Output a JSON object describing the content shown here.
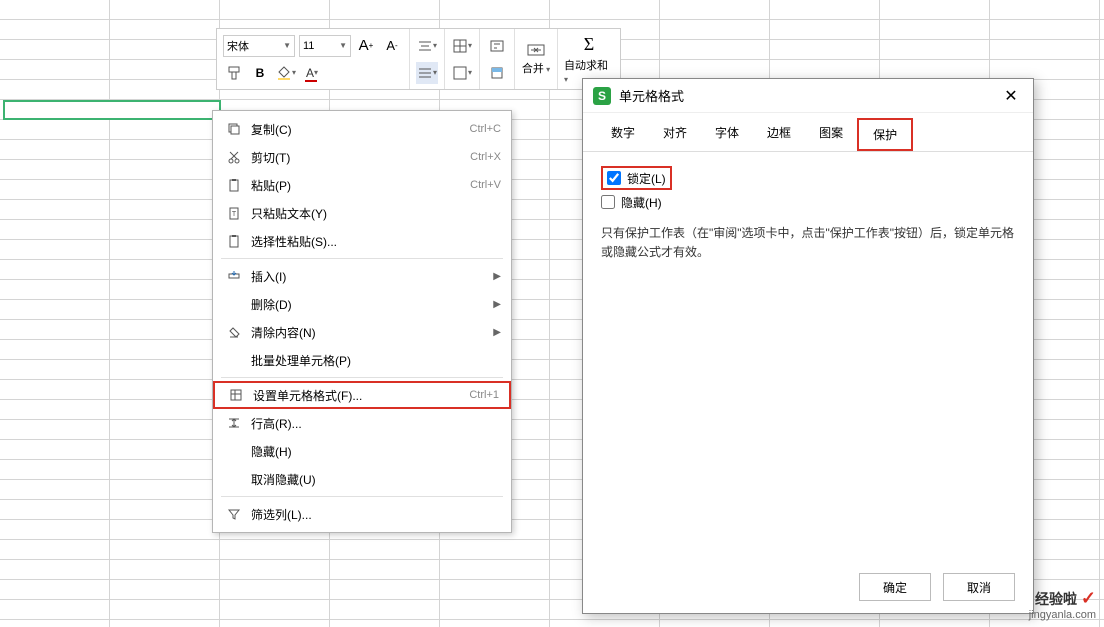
{
  "toolbar": {
    "font": "宋体",
    "size": "11",
    "merge_label": "合并",
    "autosum_label": "自动求和"
  },
  "context_menu": [
    {
      "icon": "copy",
      "label": "复制(C)",
      "shortcut": "Ctrl+C",
      "type": "item"
    },
    {
      "icon": "cut",
      "label": "剪切(T)",
      "shortcut": "Ctrl+X",
      "type": "item"
    },
    {
      "icon": "paste",
      "label": "粘贴(P)",
      "shortcut": "Ctrl+V",
      "type": "item"
    },
    {
      "icon": "paste-text",
      "label": "只粘贴文本(Y)",
      "shortcut": "",
      "type": "item"
    },
    {
      "icon": "paste-special",
      "label": "选择性粘贴(S)...",
      "shortcut": "",
      "type": "item"
    },
    {
      "type": "divider"
    },
    {
      "icon": "insert",
      "label": "插入(I)",
      "shortcut": "",
      "type": "item",
      "arrow": true
    },
    {
      "icon": "",
      "label": "删除(D)",
      "shortcut": "",
      "type": "item",
      "arrow": true
    },
    {
      "icon": "clear",
      "label": "清除内容(N)",
      "shortcut": "",
      "type": "item",
      "arrow": true
    },
    {
      "icon": "",
      "label": "批量处理单元格(P)",
      "shortcut": "",
      "type": "item"
    },
    {
      "type": "divider"
    },
    {
      "icon": "format",
      "label": "设置单元格格式(F)...",
      "shortcut": "Ctrl+1",
      "type": "item",
      "highlighted": true
    },
    {
      "icon": "row-height",
      "label": "行高(R)...",
      "shortcut": "",
      "type": "item"
    },
    {
      "icon": "",
      "label": "隐藏(H)",
      "shortcut": "",
      "type": "item"
    },
    {
      "icon": "",
      "label": "取消隐藏(U)",
      "shortcut": "",
      "type": "item"
    },
    {
      "type": "divider"
    },
    {
      "icon": "filter",
      "label": "筛选列(L)...",
      "shortcut": "",
      "type": "item"
    }
  ],
  "dialog": {
    "title": "单元格格式",
    "tabs": [
      "数字",
      "对齐",
      "字体",
      "边框",
      "图案",
      "保护"
    ],
    "active_tab": 5,
    "protection": {
      "lock_label": "锁定(L)",
      "lock_checked": true,
      "hide_label": "隐藏(H)",
      "hide_checked": false,
      "info": "只有保护工作表（在\"审阅\"选项卡中，点击\"保护工作表\"按钮）后，锁定单元格或隐藏公式才有效。"
    },
    "ok_label": "确定",
    "cancel_label": "取消"
  },
  "watermark": {
    "top": "经验啦",
    "bottom": "jingyanla.com"
  }
}
